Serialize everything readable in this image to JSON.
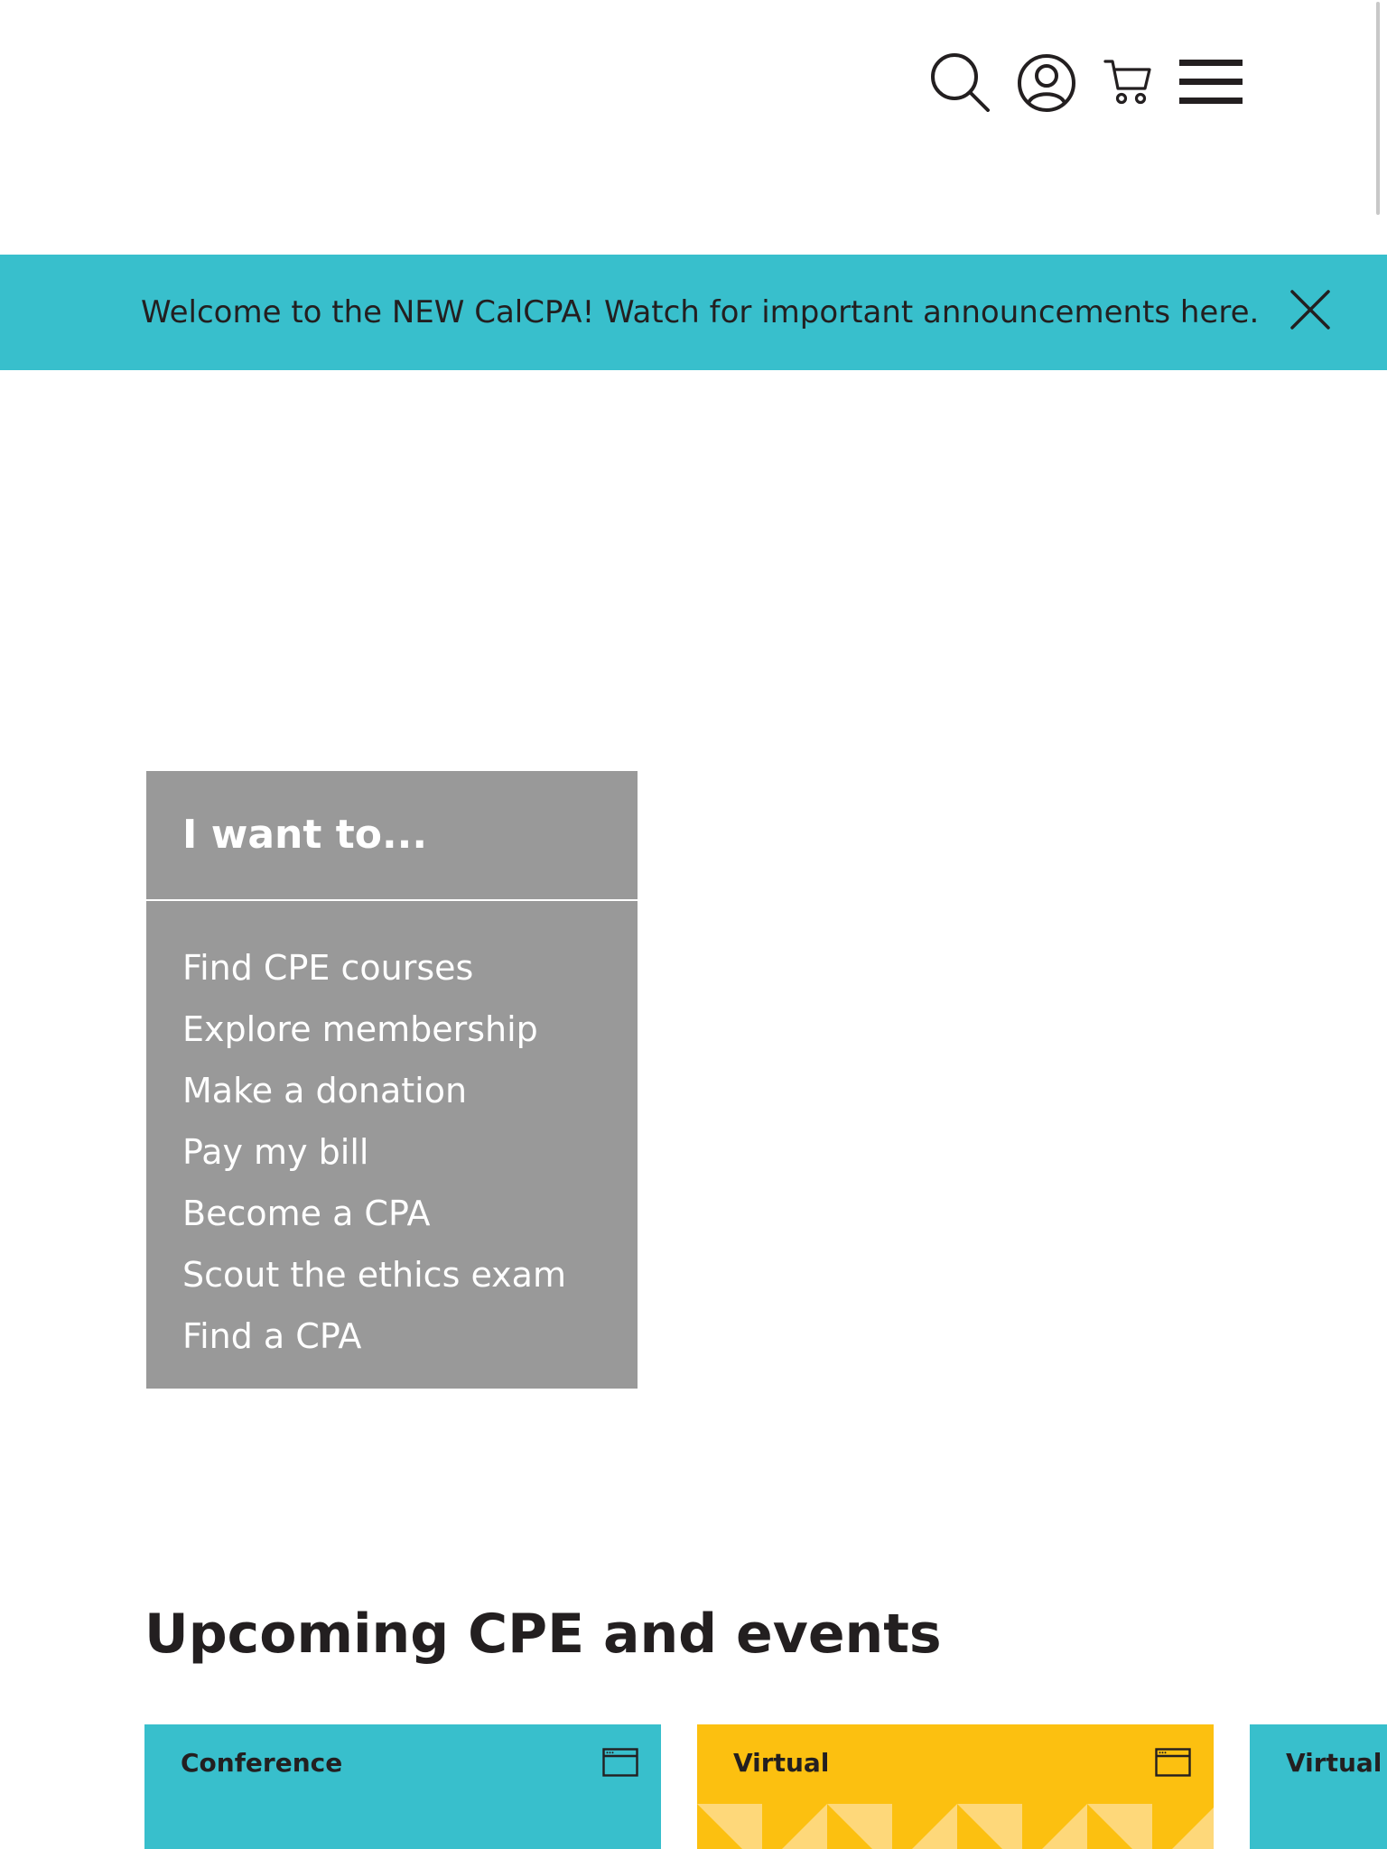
{
  "header": {
    "icons": {
      "search": "search-icon",
      "account": "user-account-icon",
      "cart": "shopping-cart-icon",
      "menu": "hamburger-menu-icon"
    }
  },
  "banner": {
    "message": "Welcome to the NEW CalCPA! Watch for important announcements here.",
    "close_icon": "close-icon",
    "color": "#38bfcc"
  },
  "want_panel": {
    "title": "I want to...",
    "items": [
      "Find CPE courses",
      "Explore membership",
      "Make a donation",
      "Pay my bill",
      "Become a CPA",
      "Scout the ethics exam",
      "Find a CPA"
    ],
    "color": "#999999"
  },
  "upcoming": {
    "title": "Upcoming CPE and events",
    "cards": [
      {
        "type": "Conference",
        "icon": "browser-window-icon",
        "color": "#38bfcc"
      },
      {
        "type": "Virtual",
        "icon": "browser-window-icon",
        "color": "#fcc010"
      },
      {
        "type": "Virtual",
        "icon": "browser-window-icon",
        "color": "#38bfcc"
      }
    ]
  }
}
